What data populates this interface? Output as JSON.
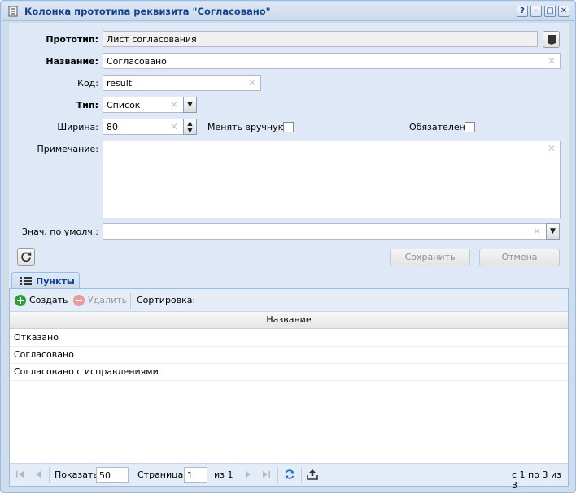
{
  "window": {
    "title": "Колонка прототипа реквизита \"Согласовано\"",
    "tools": {
      "help": "?",
      "minimize": "–",
      "maximize": "□",
      "close": "✕"
    }
  },
  "form": {
    "prototype_label": "Прототип:",
    "prototype_value": "Лист согласования",
    "name_label": "Название:",
    "name_value": "Согласовано",
    "code_label": "Код:",
    "code_value": "result",
    "type_label": "Тип:",
    "type_value": "Список",
    "width_label": "Ширина:",
    "width_value": "80",
    "manual_label": "Менять вручную:",
    "manual_checked": false,
    "required_label": "Обязателен:",
    "required_checked": false,
    "note_label": "Примечание:",
    "note_value": "",
    "default_label": "Знач. по умолч.:",
    "default_value": "",
    "save_label": "Сохранить",
    "cancel_label": "Отмена"
  },
  "tab": {
    "label": "Пункты"
  },
  "toolbar": {
    "create_label": "Создать",
    "delete_label": "Удалить",
    "sort_label": "Сортировка:"
  },
  "grid": {
    "column_name": "Название",
    "rows": [
      "Отказано",
      "Согласовано",
      "Согласовано с исправлениями"
    ]
  },
  "pager": {
    "show_label": "Показать",
    "page_size": "50",
    "page_label": "Страница",
    "page_value": "1",
    "of_label": "из 1",
    "summary": "с 1 по 3 из 3"
  },
  "colors": {
    "header_text": "#15428b",
    "panel_bg": "#dfe8f6",
    "border": "#99bbe8",
    "create_green": "#2e9d3a",
    "delete_red": "#e89b9b"
  }
}
